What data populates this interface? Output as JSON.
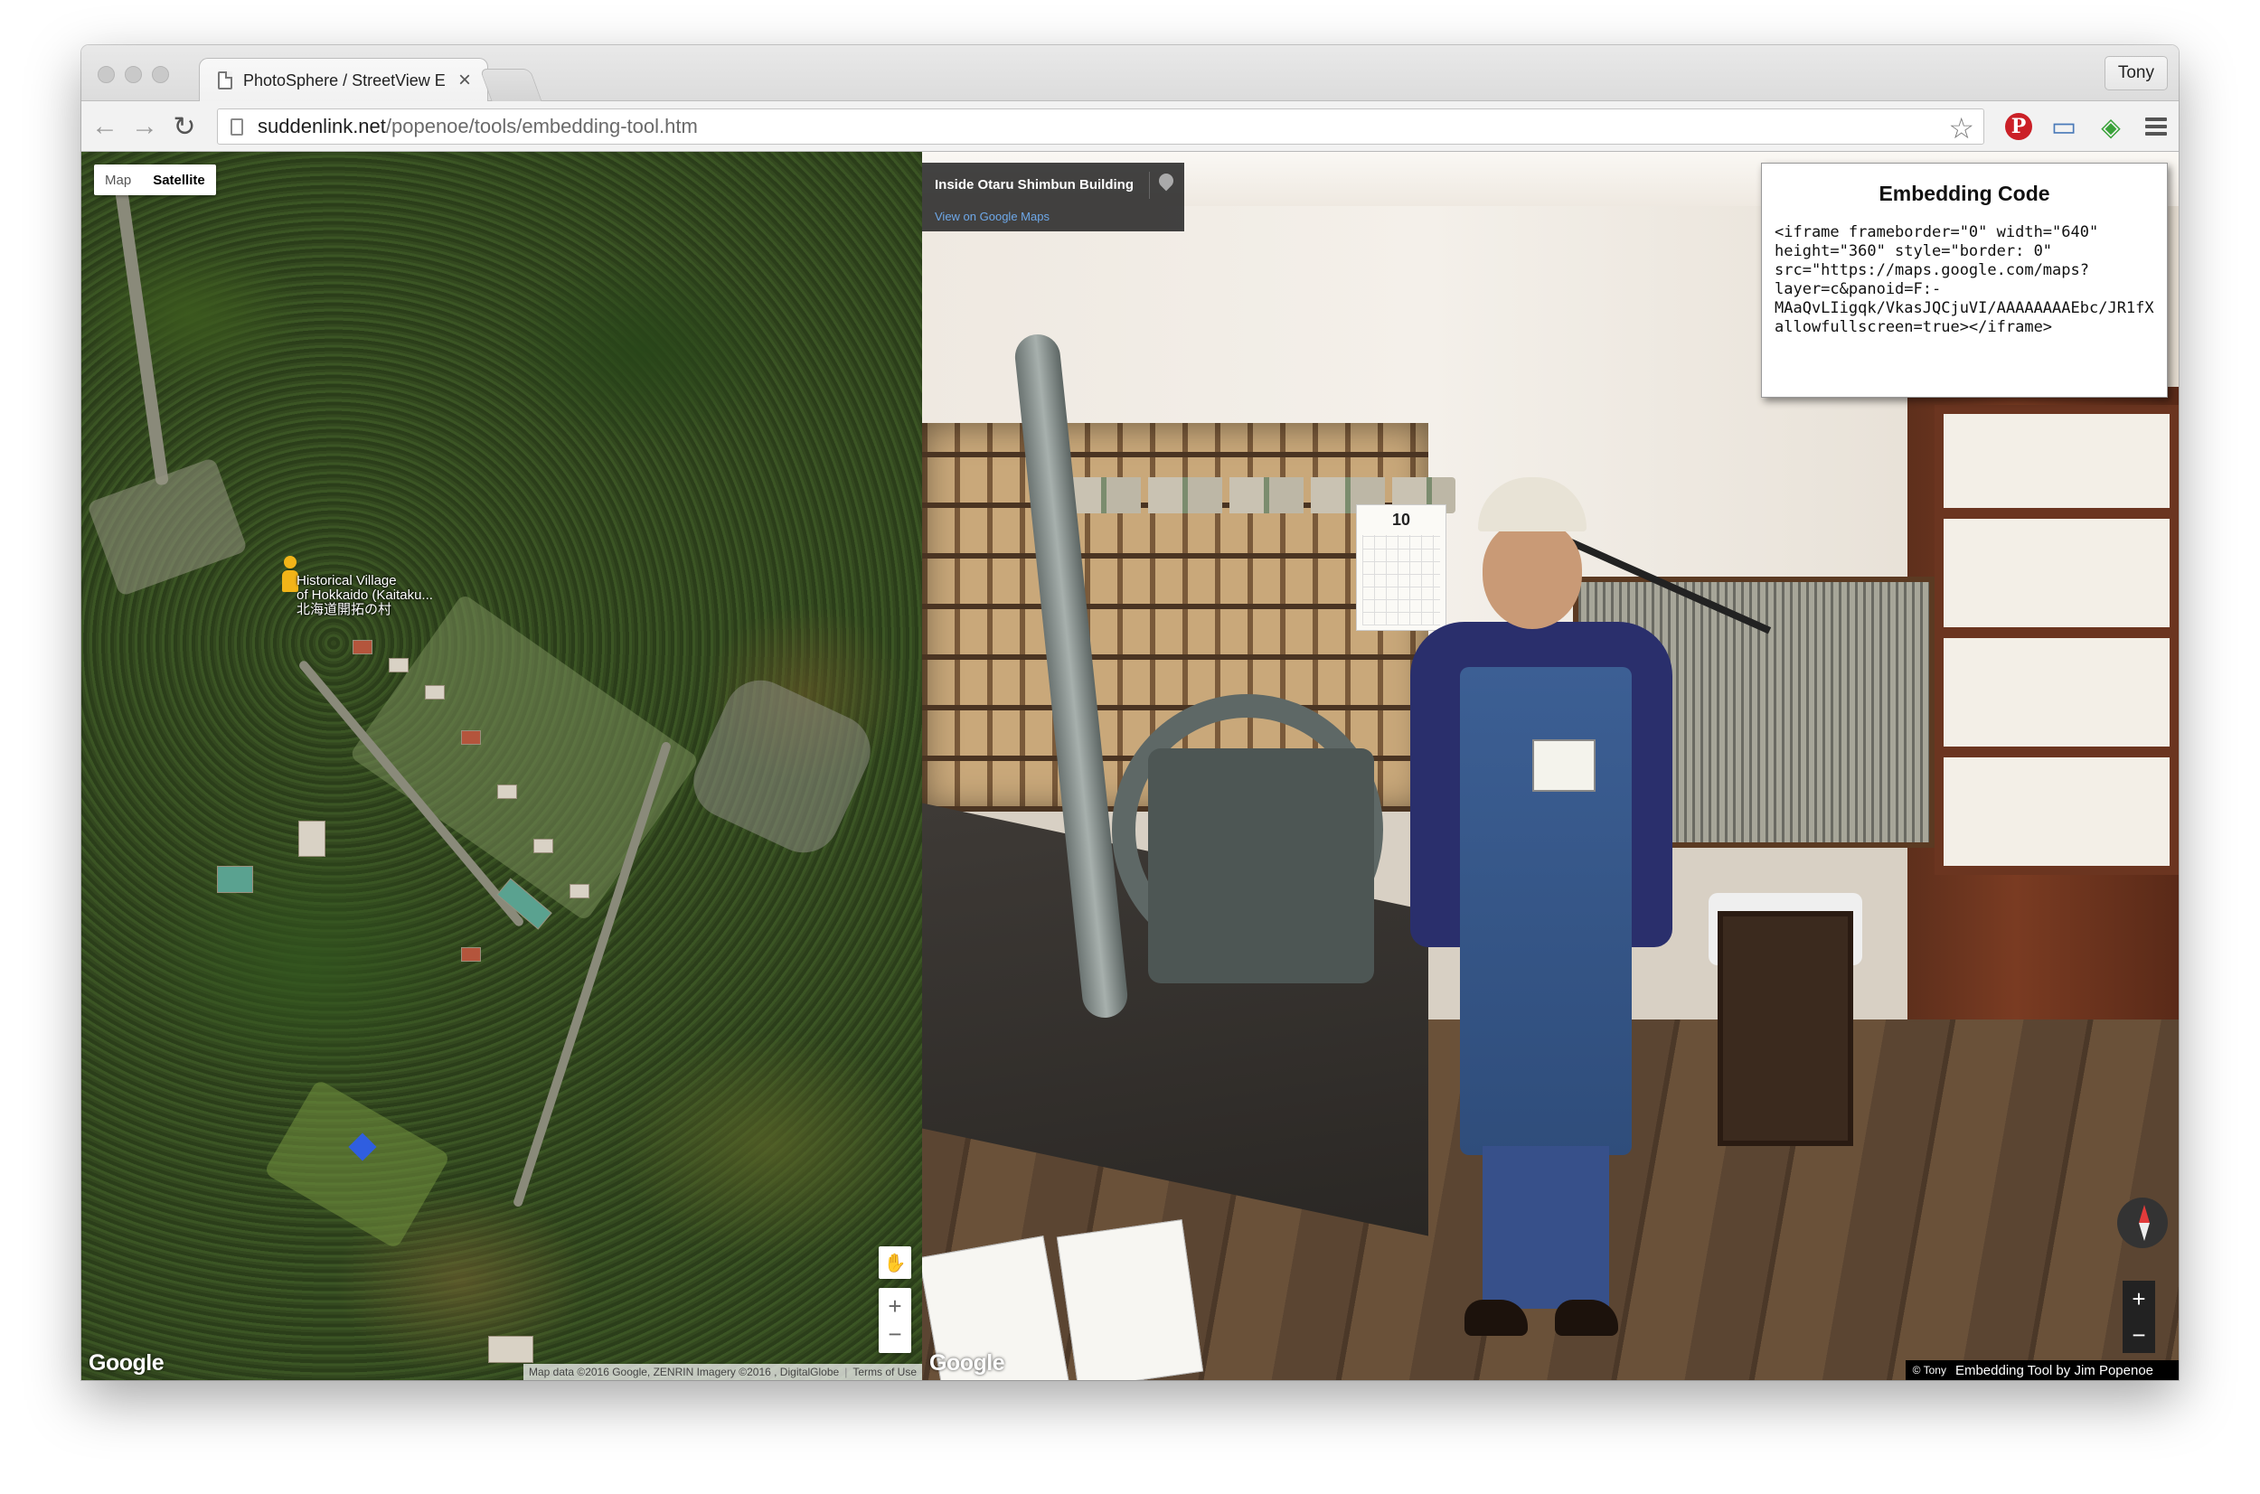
{
  "browser": {
    "tab_title": "PhotoSphere / StreetView E",
    "tab_close": "×",
    "profile_name": "Tony",
    "url_host": "suddenlink.net",
    "url_path": "/popenoe/tools/embedding-tool.htm"
  },
  "nav_icons": {
    "back": "back-arrow-icon",
    "forward": "forward-arrow-icon",
    "reload": "reload-icon",
    "bookmark": "star-icon",
    "pinterest": "pinterest-icon",
    "cast": "screen-icon",
    "extension": "eye-extension-icon",
    "menu": "hamburger-menu-icon"
  },
  "glyphs": {
    "back": "←",
    "forward": "→",
    "reload": "↻",
    "star": "☆",
    "pinterest": "P",
    "screen": "▭",
    "extension": "◈",
    "zoom_in": "+",
    "zoom_out": "−",
    "pegman_small": "✋"
  },
  "map": {
    "toggle": [
      "Map",
      "Satellite"
    ],
    "selected": "Satellite",
    "place_label_en": "Historical Village",
    "place_label_en2": "of Hokkaido (Kaitaku...",
    "place_label_jp": "北海道開拓の村",
    "google_logo": "Google",
    "attribution": "Map data ©2016 Google, ZENRIN Imagery ©2016 , DigitalGlobe",
    "terms": "Terms of Use"
  },
  "streetview": {
    "location_title": "Inside Otaru Shimbun Building",
    "view_link": "View on Google Maps",
    "calendar_month": "10",
    "google_logo": "Google",
    "copyright": "© Tony",
    "credit": "Embedding Tool by Jim Popenoe"
  },
  "embed": {
    "title": "Embedding Code",
    "code": "<iframe frameborder=\"0\" width=\"640\"\nheight=\"360\" style=\"border: 0\"\nsrc=\"https://maps.google.com/maps?\nlayer=c&panoid=F:-\nMAaQvLIigqk/VkasJQCjuVI/AAAAAAAAEbc/JR1fX\nallowfullscreen=true></iframe>"
  }
}
